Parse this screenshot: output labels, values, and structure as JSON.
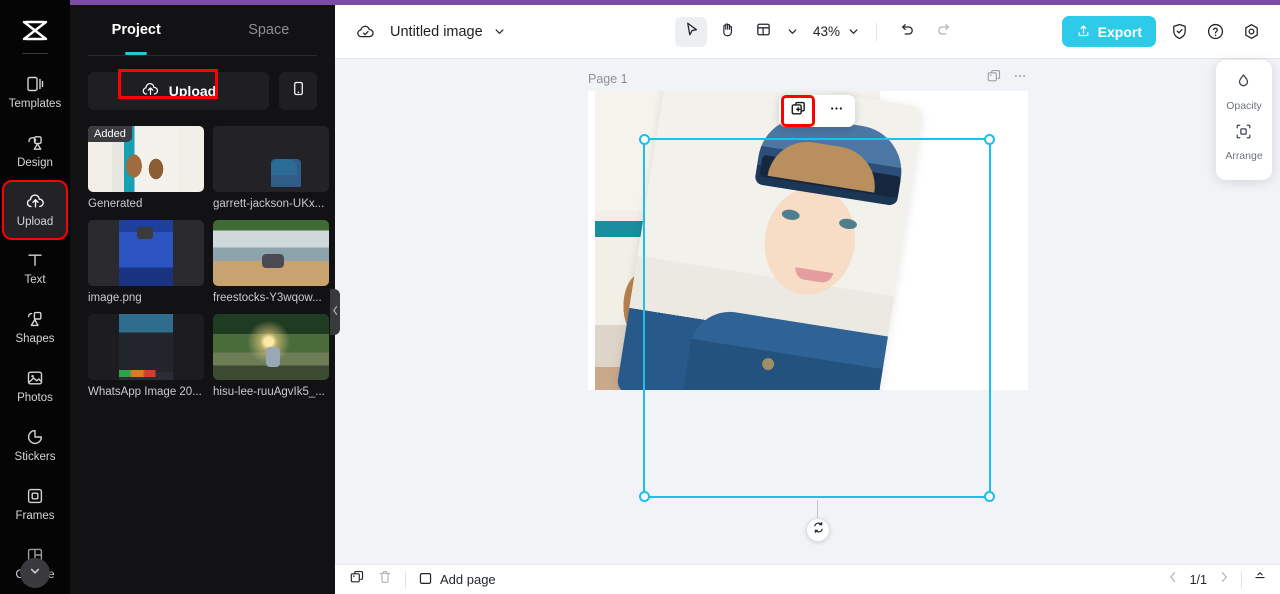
{
  "app": {
    "name": "CapCut",
    "logo_icon": "capcut-logo-icon"
  },
  "theme": {
    "accent": "#2ecaea",
    "selection": "#19c0e8",
    "highlight": "#ff0000",
    "purple_strip": "#7b4ba6"
  },
  "sidebar": {
    "items": [
      {
        "label": "Templates",
        "icon": "templates-icon",
        "active": false
      },
      {
        "label": "Design",
        "icon": "design-icon",
        "active": false
      },
      {
        "label": "Upload",
        "icon": "upload-cloud-icon",
        "active": true,
        "highlighted": true
      },
      {
        "label": "Text",
        "icon": "text-icon",
        "active": false
      },
      {
        "label": "Shapes",
        "icon": "shapes-icon",
        "active": false
      },
      {
        "label": "Photos",
        "icon": "photos-icon",
        "active": false
      },
      {
        "label": "Stickers",
        "icon": "stickers-icon",
        "active": false
      },
      {
        "label": "Frames",
        "icon": "frames-icon",
        "active": false
      },
      {
        "label": "Collage",
        "icon": "collage-icon",
        "active": false
      }
    ],
    "collapse_icon": "chevron-down-icon"
  },
  "panel": {
    "tabs": [
      {
        "label": "Project",
        "active": true
      },
      {
        "label": "Space",
        "active": false
      }
    ],
    "upload_button": {
      "label": "Upload",
      "icon": "upload-cloud-icon",
      "highlighted": true
    },
    "mobile_button": {
      "icon": "mobile-phone-icon"
    },
    "media": [
      {
        "label": "Generated",
        "badge": "Added",
        "art": "art-dogs"
      },
      {
        "label": "garrett-jackson-UKx...",
        "badge": "",
        "art": "art-boy"
      },
      {
        "label": "image.png",
        "badge": "",
        "art": "art-blue"
      },
      {
        "label": "freestocks-Y3wqow...",
        "badge": "",
        "art": "art-lake"
      },
      {
        "label": "WhatsApp Image 20...",
        "badge": "",
        "art": "art-man"
      },
      {
        "label": "hisu-lee-ruuAgvIk5_...",
        "badge": "",
        "art": "art-sun"
      }
    ],
    "collapse_handle_icon": "chevron-left-icon"
  },
  "topbar": {
    "cloud_icon": "cloud-save-icon",
    "title": "Untitled image",
    "title_chevron_icon": "chevron-down-icon",
    "tools": [
      {
        "name": "select-tool",
        "icon": "cursor-arrow-icon",
        "selected": true
      },
      {
        "name": "hand-tool",
        "icon": "hand-icon",
        "selected": false
      },
      {
        "name": "layout-tool",
        "icon": "layout-grid-icon",
        "selected": false
      }
    ],
    "layout_chevron_icon": "chevron-down-icon",
    "zoom": "43%",
    "zoom_chevron_icon": "chevron-down-icon",
    "undo": {
      "icon": "undo-icon",
      "enabled": true
    },
    "redo": {
      "icon": "redo-icon",
      "enabled": false
    },
    "export": {
      "label": "Export",
      "icon": "export-upload-icon"
    },
    "shield": {
      "icon": "shield-check-icon"
    },
    "help": {
      "icon": "help-circle-icon"
    },
    "settings": {
      "icon": "settings-gear-icon"
    }
  },
  "canvas": {
    "page_label": "Page 1",
    "page_duplicate_icon": "duplicate-page-icon",
    "page_more_icon": "more-options-icon",
    "float_toolbar": {
      "duplicate": {
        "icon": "duplicate-layers-icon",
        "highlighted": true
      },
      "more": {
        "icon": "more-options-icon",
        "highlighted": false
      }
    },
    "rotate_handle_icon": "rotate-icon",
    "selected_layer": "photo-boy"
  },
  "properties": {
    "items": [
      {
        "label": "Opacity",
        "icon": "opacity-droplet-icon"
      },
      {
        "label": "Arrange",
        "icon": "arrange-icon"
      }
    ]
  },
  "bottombar": {
    "duplicate_icon": "duplicate-page-icon",
    "delete_icon": "trash-icon",
    "add_page": {
      "label": "Add page",
      "icon": "add-page-icon"
    },
    "prev_icon": "chevron-left-icon",
    "next_icon": "chevron-right-icon",
    "page_indicator": "1/1",
    "expand_icon": "expand-up-icon"
  }
}
